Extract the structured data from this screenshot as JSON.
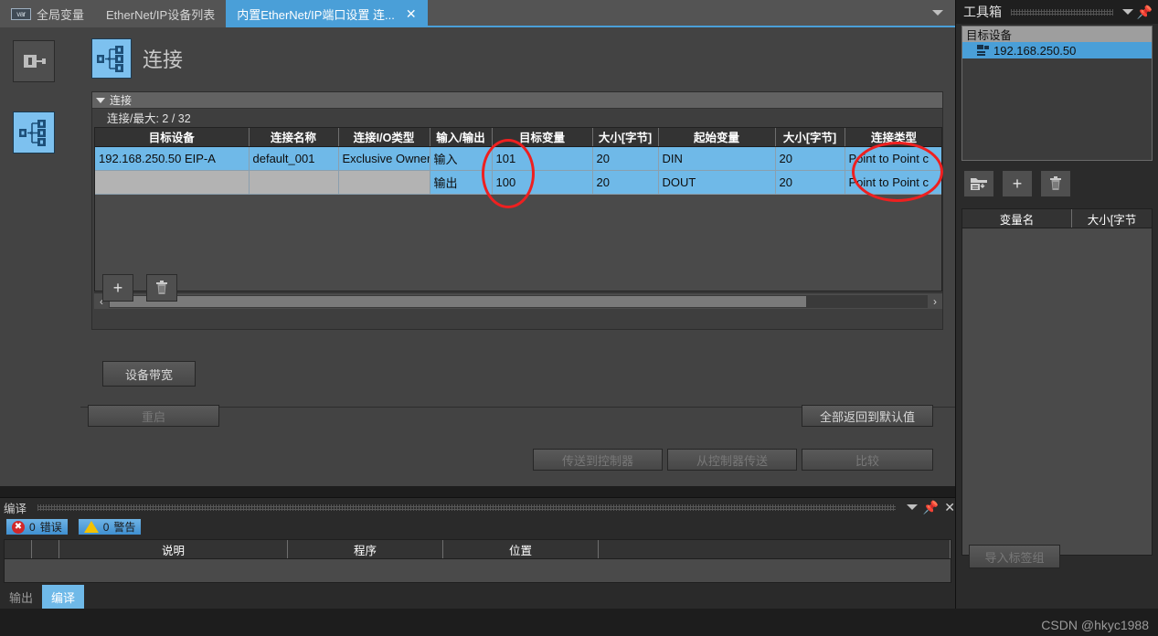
{
  "tabs": [
    {
      "label": "全局变量",
      "icon": "var-icon",
      "active": false,
      "closable": false
    },
    {
      "label": "EtherNet/IP设备列表",
      "icon": "",
      "active": false,
      "closable": false
    },
    {
      "label": "内置EtherNet/IP端口设置 连...",
      "icon": "",
      "active": true,
      "closable": true
    }
  ],
  "tab_close_glyph": "✕",
  "tab_dropdown_icon": "chevron-down-icon",
  "rail": {
    "items": [
      {
        "name": "device-settings-icon",
        "selected": false
      },
      {
        "name": "connection-tree-icon",
        "selected": true
      }
    ]
  },
  "page": {
    "icon": "connection-tree-icon",
    "title": "连接"
  },
  "group": {
    "header": "连接",
    "subtitle": "连接/最大: 2 / 32"
  },
  "table": {
    "columns": [
      {
        "label": "目标设备",
        "width": 168
      },
      {
        "label": "连接名称",
        "width": 98
      },
      {
        "label": "连接I/O类型",
        "width": 100
      },
      {
        "label": "输入/输出",
        "width": 68
      },
      {
        "label": "目标变量",
        "width": 110
      },
      {
        "label": "大小[字节]",
        "width": 72
      },
      {
        "label": "起始变量",
        "width": 128
      },
      {
        "label": "大小[字节]",
        "width": 76
      },
      {
        "label": "连接类型",
        "width": 108
      },
      {
        "label": "",
        "width": 12
      }
    ],
    "rows": [
      {
        "selected": true,
        "cells": [
          "192.168.250.50 EIP-A",
          "default_001",
          "Exclusive Owner",
          "输入",
          "101",
          "20",
          "DIN",
          "20",
          "Point to Point c",
          ""
        ]
      },
      {
        "selected": false,
        "highlight_from": 3,
        "cells": [
          "",
          "",
          "",
          "输出",
          "100",
          "20",
          "DOUT",
          "20",
          "Point to Point c",
          ""
        ]
      }
    ],
    "scroll_arrows": {
      "left": "‹",
      "right": "›"
    },
    "scroll_thumb_pct": 85
  },
  "toolbar": {
    "add_label": "+",
    "delete_icon": "trash-icon",
    "bandwidth_label": "设备带宽"
  },
  "footer": {
    "restart_label": "重启",
    "restart_disabled": true,
    "reset_defaults_label": "全部返回到默认值",
    "transfer_to_controller_label": "传送到控制器",
    "transfer_from_controller_label": "从控制器传送",
    "compare_label": "比较",
    "transfer_disabled": true
  },
  "compile": {
    "title": "编译",
    "collapse_icon": "chevron-down-icon",
    "pin_icon": "pin-icon",
    "close_icon": "close-icon",
    "error_count": "0",
    "error_label": "错误",
    "error_glyph": "✖",
    "warning_count": "0",
    "warning_label": "警告",
    "warning_glyph": "!",
    "columns": [
      "",
      "",
      "说明",
      "程序",
      "位置",
      ""
    ],
    "tabs": [
      {
        "label": "输出",
        "active": false
      },
      {
        "label": "编译",
        "active": true
      }
    ]
  },
  "toolbox": {
    "title": "工具箱",
    "collapse_icon": "chevron-down-icon",
    "pin_icon": "pin-icon",
    "device_panel_header": "目标设备",
    "device_items": [
      {
        "label": "192.168.250.50",
        "icon": "device-node-icon",
        "selected": true
      }
    ],
    "buttons": [
      {
        "name": "import-device-button",
        "icon": "folder-import-icon"
      },
      {
        "name": "add-device-button",
        "icon": "plus-icon",
        "glyph": "+"
      },
      {
        "name": "delete-device-button",
        "icon": "trash-icon"
      }
    ],
    "variable_columns": [
      "变量名",
      "大小[字节"
    ],
    "import_tag_label": "导入标签组"
  },
  "watermark": "CSDN @hkyc1988",
  "colors": {
    "accent_blue": "#4a9fd8",
    "row_selected": "#6fb9e8",
    "row_alt": "#b3b3b3",
    "panel_bg": "#434343",
    "annotation_red": "#ee2020"
  }
}
